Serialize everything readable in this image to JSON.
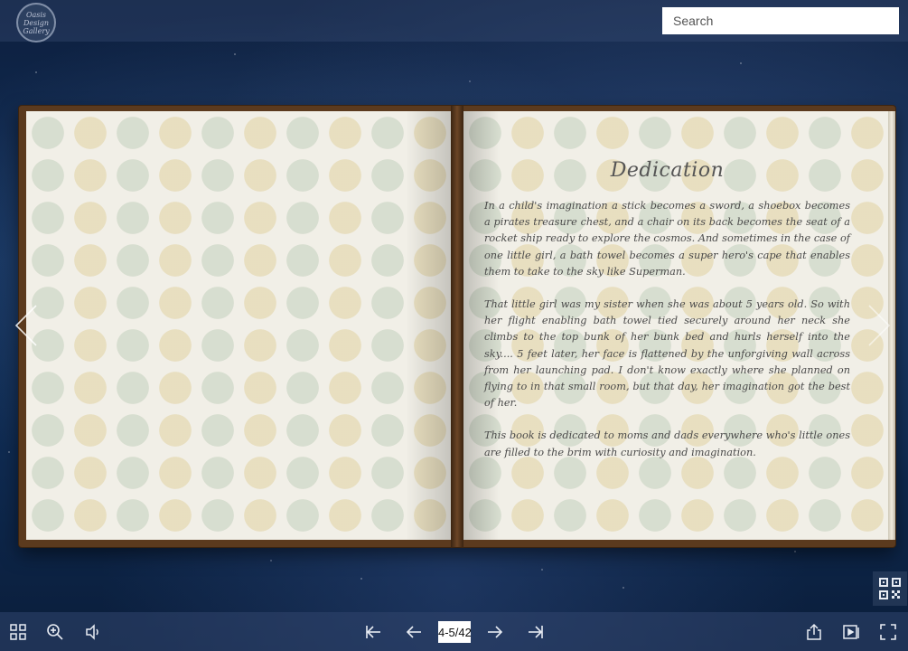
{
  "header": {
    "logo_text": "Oasis Design Gallery",
    "search_placeholder": "Search"
  },
  "book": {
    "right_page": {
      "title": "Dedication",
      "paragraphs": [
        "In a child's imagination a stick becomes a sword, a shoebox becomes a pirates treasure chest, and a chair on its back becomes the seat of a rocket ship ready to explore the cosmos. And sometimes in the case of one little girl, a bath towel becomes a super hero's cape that enables them to take to the sky like Superman.",
        "That little girl was my sister when she was about 5 years old. So with her flight enabling bath towel tied securely around her neck she climbs to the top bunk of her bunk bed and hurls herself into the sky.... 5 feet later, her face is flattened by the unforgiving wall across from her launching pad. I don't know exactly where she planned on flying to in that small room, but that day, her imagination got the best of her.",
        "This book is dedicated to moms and dads everywhere who's little ones are filled to the brim with curiosity and imagination."
      ]
    }
  },
  "toolbar": {
    "page_indicator": "4-5/42"
  },
  "icons": {
    "thumbnails": "thumbnails-icon",
    "zoom": "zoom-in-icon",
    "sound": "sound-icon",
    "first": "first-page-icon",
    "prev": "previous-page-icon",
    "next": "next-page-icon",
    "last": "last-page-icon",
    "share": "share-icon",
    "autoplay": "autoplay-icon",
    "fullscreen": "fullscreen-icon",
    "qr": "qr-code-icon"
  }
}
